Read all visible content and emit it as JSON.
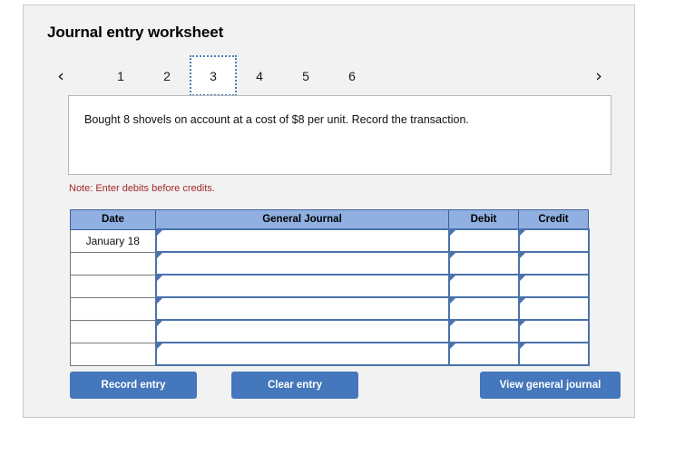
{
  "worksheet": {
    "title": "Journal entry worksheet",
    "nav": {
      "prev_icon": "chevron-left-icon",
      "prev_glyph": "‹",
      "next_icon": "chevron-right-icon",
      "next_glyph": "›"
    },
    "tabs": [
      {
        "label": "1",
        "active": false
      },
      {
        "label": "2",
        "active": false
      },
      {
        "label": "3",
        "active": true
      },
      {
        "label": "4",
        "active": false
      },
      {
        "label": "5",
        "active": false
      },
      {
        "label": "6",
        "active": false
      }
    ],
    "prompt": "Bought 8 shovels on account at a cost of $8 per unit. Record the transaction.",
    "note": "Note: Enter debits before credits."
  },
  "table": {
    "headers": [
      "Date",
      "General Journal",
      "Debit",
      "Credit"
    ],
    "rows": [
      {
        "date": "January 18",
        "general_journal": "",
        "debit": "",
        "credit": ""
      },
      {
        "date": "",
        "general_journal": "",
        "debit": "",
        "credit": ""
      },
      {
        "date": "",
        "general_journal": "",
        "debit": "",
        "credit": ""
      },
      {
        "date": "",
        "general_journal": "",
        "debit": "",
        "credit": ""
      },
      {
        "date": "",
        "general_journal": "",
        "debit": "",
        "credit": ""
      },
      {
        "date": "",
        "general_journal": "",
        "debit": "",
        "credit": ""
      }
    ]
  },
  "buttons": {
    "record": "Record entry",
    "clear": "Clear entry",
    "view": "View general journal"
  },
  "colors": {
    "button_blue": "#4477bb",
    "header_blue": "#8fb0e0",
    "cell_border_blue": "#4a72ab",
    "active_tab_border": "#4a7ebb",
    "note_red": "#a02b2b",
    "card_background": "#f2f2f2"
  }
}
